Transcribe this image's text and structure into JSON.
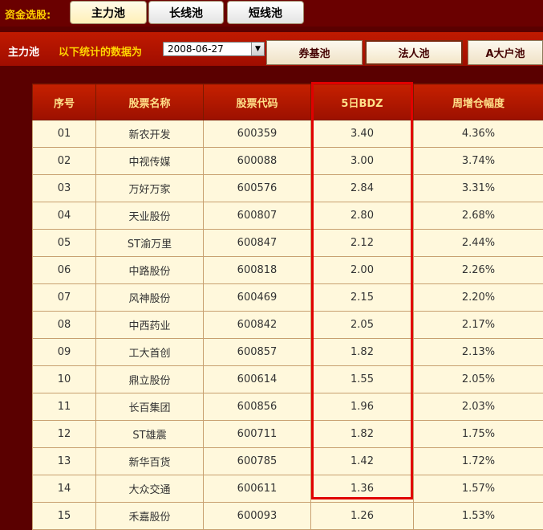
{
  "top_bar": {
    "label": "资金选股:",
    "tabs": [
      {
        "label": "主力池",
        "active": true
      },
      {
        "label": "长线池",
        "active": false
      },
      {
        "label": "短线池",
        "active": false
      }
    ]
  },
  "sub_bar": {
    "pool_name": "主力池",
    "date_hint": "以下统计的数据为",
    "date_value": "2008-06-27",
    "pools": [
      {
        "label": "券基池",
        "selected": false
      },
      {
        "label": "法人池",
        "selected": true
      },
      {
        "label": "A大户池",
        "selected": false
      }
    ]
  },
  "table": {
    "headers": [
      "序号",
      "股票名称",
      "股票代码",
      "5日BDZ",
      "周增仓幅度"
    ],
    "highlighted_column": "5日BDZ",
    "rows": [
      [
        "01",
        "新农开发",
        "600359",
        "3.40",
        "4.36%"
      ],
      [
        "02",
        "中视传媒",
        "600088",
        "3.00",
        "3.74%"
      ],
      [
        "03",
        "万好万家",
        "600576",
        "2.84",
        "3.31%"
      ],
      [
        "04",
        "天业股份",
        "600807",
        "2.80",
        "2.68%"
      ],
      [
        "05",
        "ST渝万里",
        "600847",
        "2.12",
        "2.44%"
      ],
      [
        "06",
        "中路股份",
        "600818",
        "2.00",
        "2.26%"
      ],
      [
        "07",
        "风神股份",
        "600469",
        "2.15",
        "2.20%"
      ],
      [
        "08",
        "中西药业",
        "600842",
        "2.05",
        "2.17%"
      ],
      [
        "09",
        "工大首创",
        "600857",
        "1.82",
        "2.13%"
      ],
      [
        "10",
        "鼎立股份",
        "600614",
        "1.55",
        "2.05%"
      ],
      [
        "11",
        "长百集团",
        "600856",
        "1.96",
        "2.03%"
      ],
      [
        "12",
        "ST雄震",
        "600711",
        "1.82",
        "1.75%"
      ],
      [
        "13",
        "新华百货",
        "600785",
        "1.42",
        "1.72%"
      ],
      [
        "14",
        "大众交通",
        "600611",
        "1.36",
        "1.57%"
      ],
      [
        "15",
        "禾嘉股份",
        "600093",
        "1.26",
        "1.53%"
      ]
    ]
  },
  "colors": {
    "highlight_border": "#e00000",
    "header_bg": "#b51800",
    "row_bg": "#fff8dc"
  }
}
